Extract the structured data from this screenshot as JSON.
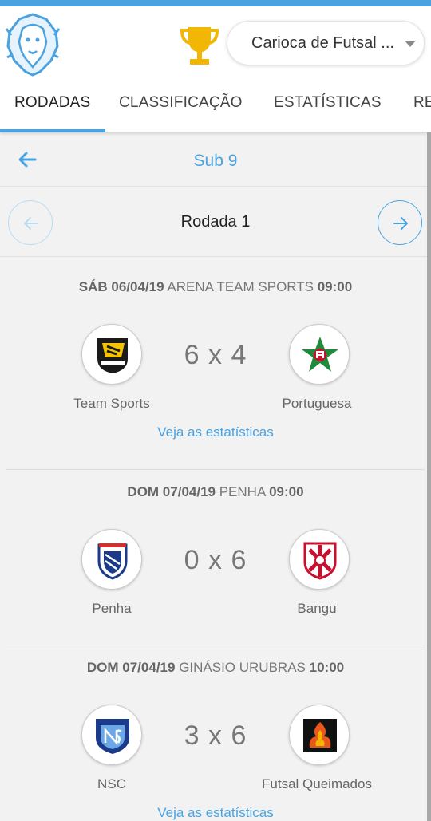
{
  "header": {
    "logo_icon": "lion-logo",
    "trophy_icon": "trophy-icon",
    "championship_select": "Carioca de Futsal ..."
  },
  "tabs": [
    {
      "label": "RODADAS",
      "active": true
    },
    {
      "label": "CLASSIFICAÇÃO",
      "active": false
    },
    {
      "label": "ESTATÍSTICAS",
      "active": false
    },
    {
      "label": "RE",
      "active": false
    }
  ],
  "subheader": {
    "back_icon": "arrow-left-icon",
    "title": "Sub 9"
  },
  "round": {
    "title": "Rodada 1",
    "prev_icon": "arrow-left-icon",
    "next_icon": "arrow-right-icon"
  },
  "matches": [
    {
      "day_date": "SÁB 06/04/19",
      "venue": "ARENA TEAM SPORTS",
      "time": "09:00",
      "score": "6 x 4",
      "home": "Team Sports",
      "away": "Portuguesa",
      "stats_link": "Veja as estatísticas"
    },
    {
      "day_date": "DOM 07/04/19",
      "venue": "PENHA",
      "time": "09:00",
      "score": "0 x 6",
      "home": "Penha",
      "away": "Bangu",
      "stats_link": ""
    },
    {
      "day_date": "DOM 07/04/19",
      "venue": "GINÁSIO URUBRAS",
      "time": "10:00",
      "score": "3 x 6",
      "home": "NSC",
      "away": "Futsal Queimados",
      "stats_link": "Veja as estatísticas"
    }
  ],
  "colors": {
    "accent": "#4aa3e0",
    "background": "#f2f2f2",
    "trophy": "#f2b705"
  }
}
